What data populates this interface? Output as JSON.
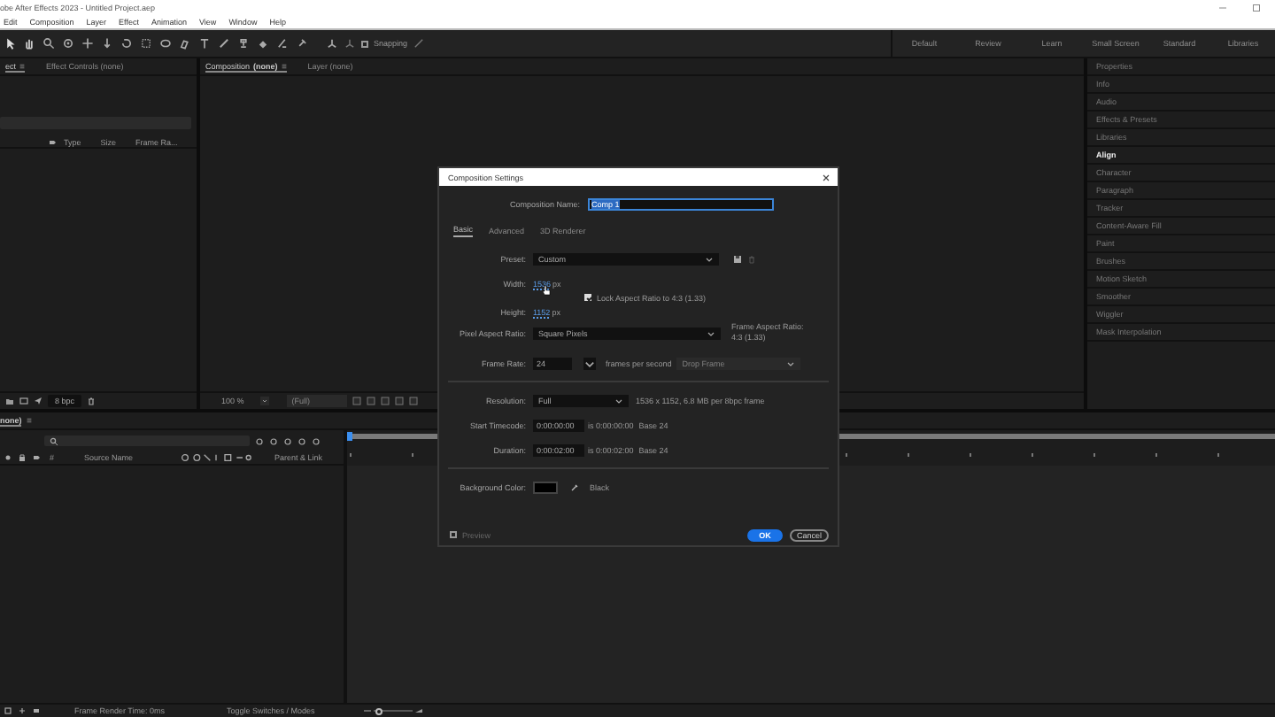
{
  "window": {
    "title": "obe After Effects 2023 - Untitled Project.aep"
  },
  "menu": [
    "Edit",
    "Composition",
    "Layer",
    "Effect",
    "Animation",
    "View",
    "Window",
    "Help"
  ],
  "toolbar": {
    "snapping": {
      "label": "Snapping",
      "checked": false
    }
  },
  "workspaces": [
    "Default",
    "Review",
    "Learn",
    "Small Screen",
    "Standard",
    "Libraries"
  ],
  "project_panel": {
    "tabs": [
      {
        "label": "ect",
        "selected": true
      },
      {
        "label": "Effect Controls (none)",
        "selected": false
      }
    ],
    "columns": [
      "Type",
      "Size",
      "Frame Ra..."
    ],
    "bit_depth": "8 bpc"
  },
  "composition_panel": {
    "tabs": [
      {
        "label": "Composition **(none)**",
        "selected": true
      },
      {
        "label": "Layer (none)",
        "selected": false
      }
    ],
    "zoom": "100 %",
    "resolution": "(Full)"
  },
  "right_panel": {
    "items": [
      {
        "label": "Properties",
        "selected": false
      },
      {
        "label": "Info",
        "selected": false
      },
      {
        "label": "Audio",
        "selected": false
      },
      {
        "label": "Effects & Presets",
        "selected": false
      },
      {
        "label": "Libraries",
        "selected": false
      },
      {
        "label": "Align",
        "selected": true
      },
      {
        "label": "Character",
        "selected": false
      },
      {
        "label": "Paragraph",
        "selected": false
      },
      {
        "label": "Tracker",
        "selected": false
      },
      {
        "label": "Content-Aware Fill",
        "selected": false
      },
      {
        "label": "Paint",
        "selected": false
      },
      {
        "label": "Brushes",
        "selected": false
      },
      {
        "label": "Motion Sketch",
        "selected": false
      },
      {
        "label": "Smoother",
        "selected": false
      },
      {
        "label": "Wiggler",
        "selected": false
      },
      {
        "label": "Mask Interpolation",
        "selected": false
      }
    ]
  },
  "timeline": {
    "tab": "none)",
    "columns": [
      "#",
      "Source Name",
      "Parent & Link"
    ],
    "render_time": "Frame Render Time: 0ms",
    "toggle": "Toggle Switches / Modes",
    "zoom": {
      "level": 0.15
    }
  },
  "dialog": {
    "title": "Composition Settings",
    "name_label": "Composition Name:",
    "name_value": "Comp 1",
    "tabs": [
      {
        "label": "Basic",
        "selected": true
      },
      {
        "label": "Advanced",
        "selected": false
      },
      {
        "label": "3D Renderer",
        "selected": false
      }
    ],
    "preset": {
      "label": "Preset:",
      "value": "Custom"
    },
    "width": {
      "label": "Width:",
      "value": "1536",
      "unit": "px"
    },
    "lock_aspect": {
      "label": "Lock Aspect Ratio to 4:3 (1.33)",
      "checked": true
    },
    "height": {
      "label": "Height:",
      "value": "1152",
      "unit": "px"
    },
    "pixel_aspect": {
      "label": "Pixel Aspect Ratio:",
      "value": "Square Pixels"
    },
    "frame_aspect": {
      "label": "Frame Aspect Ratio:",
      "value": "4:3 (1.33)"
    },
    "frame_rate": {
      "label": "Frame Rate:",
      "value": "24",
      "unit": "frames per second",
      "drop_frame": {
        "value": "Drop Frame",
        "disabled": true
      }
    },
    "resolution": {
      "label": "Resolution:",
      "value": "Full",
      "info": "1536 x 1152, 6.8 MB per 8bpc frame"
    },
    "start_timecode": {
      "label": "Start Timecode:",
      "value": "0:00:00:00",
      "info": "is 0:00:00:00",
      "base": "Base 24"
    },
    "duration": {
      "label": "Duration:",
      "value": "0:00:02:00",
      "info": "is 0:00:02:00",
      "base": "Base 24"
    },
    "background": {
      "label": "Background Color:",
      "color": "#000000",
      "name": "Black"
    },
    "preview": {
      "label": "Preview",
      "checked": false
    },
    "buttons": [
      {
        "label": "OK",
        "kind": "primary"
      },
      {
        "label": "Cancel",
        "kind": "secondary"
      }
    ]
  }
}
